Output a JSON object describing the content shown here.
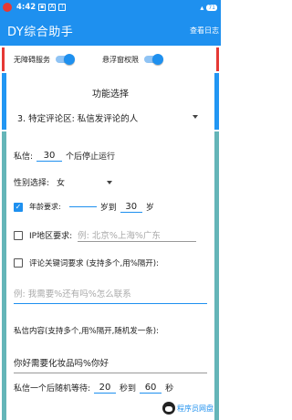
{
  "status_bar": {
    "time": "4:42",
    "battery": "71"
  },
  "app_bar": {
    "title": "DY综合助手",
    "log_button": "查看日志"
  },
  "permissions": {
    "accessibility_label": "无障碍服务",
    "overlay_label": "悬浮窗权限"
  },
  "function": {
    "title": "功能选择",
    "selected": "3. 特定评论区: 私信发评论的人"
  },
  "settings": {
    "dm_stop_prefix": "私信:",
    "dm_stop_value": "30",
    "dm_stop_suffix": "个后停止运行",
    "gender_label": "性别选择:",
    "gender_value": "女",
    "age_label": "年龄要求:",
    "age_from": "",
    "age_mid": "岁到",
    "age_to": "30",
    "age_suffix": "岁",
    "ip_label": "IP地区要求:",
    "ip_placeholder": "例: 北京%上海%广东",
    "keyword_label": "评论关键词要求 (支持多个,用%隔开):",
    "keyword_placeholder": "例: 我需要%还有吗%怎么联系",
    "content_label": "私信内容(支持多个,用%隔开,随机发一条):",
    "content_value": "你好需要化妆品吗%你好",
    "wait_prefix": "私信一个后随机等待:",
    "wait_from": "20",
    "wait_mid": "秒到",
    "wait_to": "60",
    "wait_suffix": "秒"
  },
  "watermark": {
    "text": "程序员网盘"
  },
  "colors": {
    "primary": "#1e90ef",
    "accent_red": "#e53935",
    "accent_blue": "#2196f3",
    "accent_teal": "#64b5b8"
  }
}
